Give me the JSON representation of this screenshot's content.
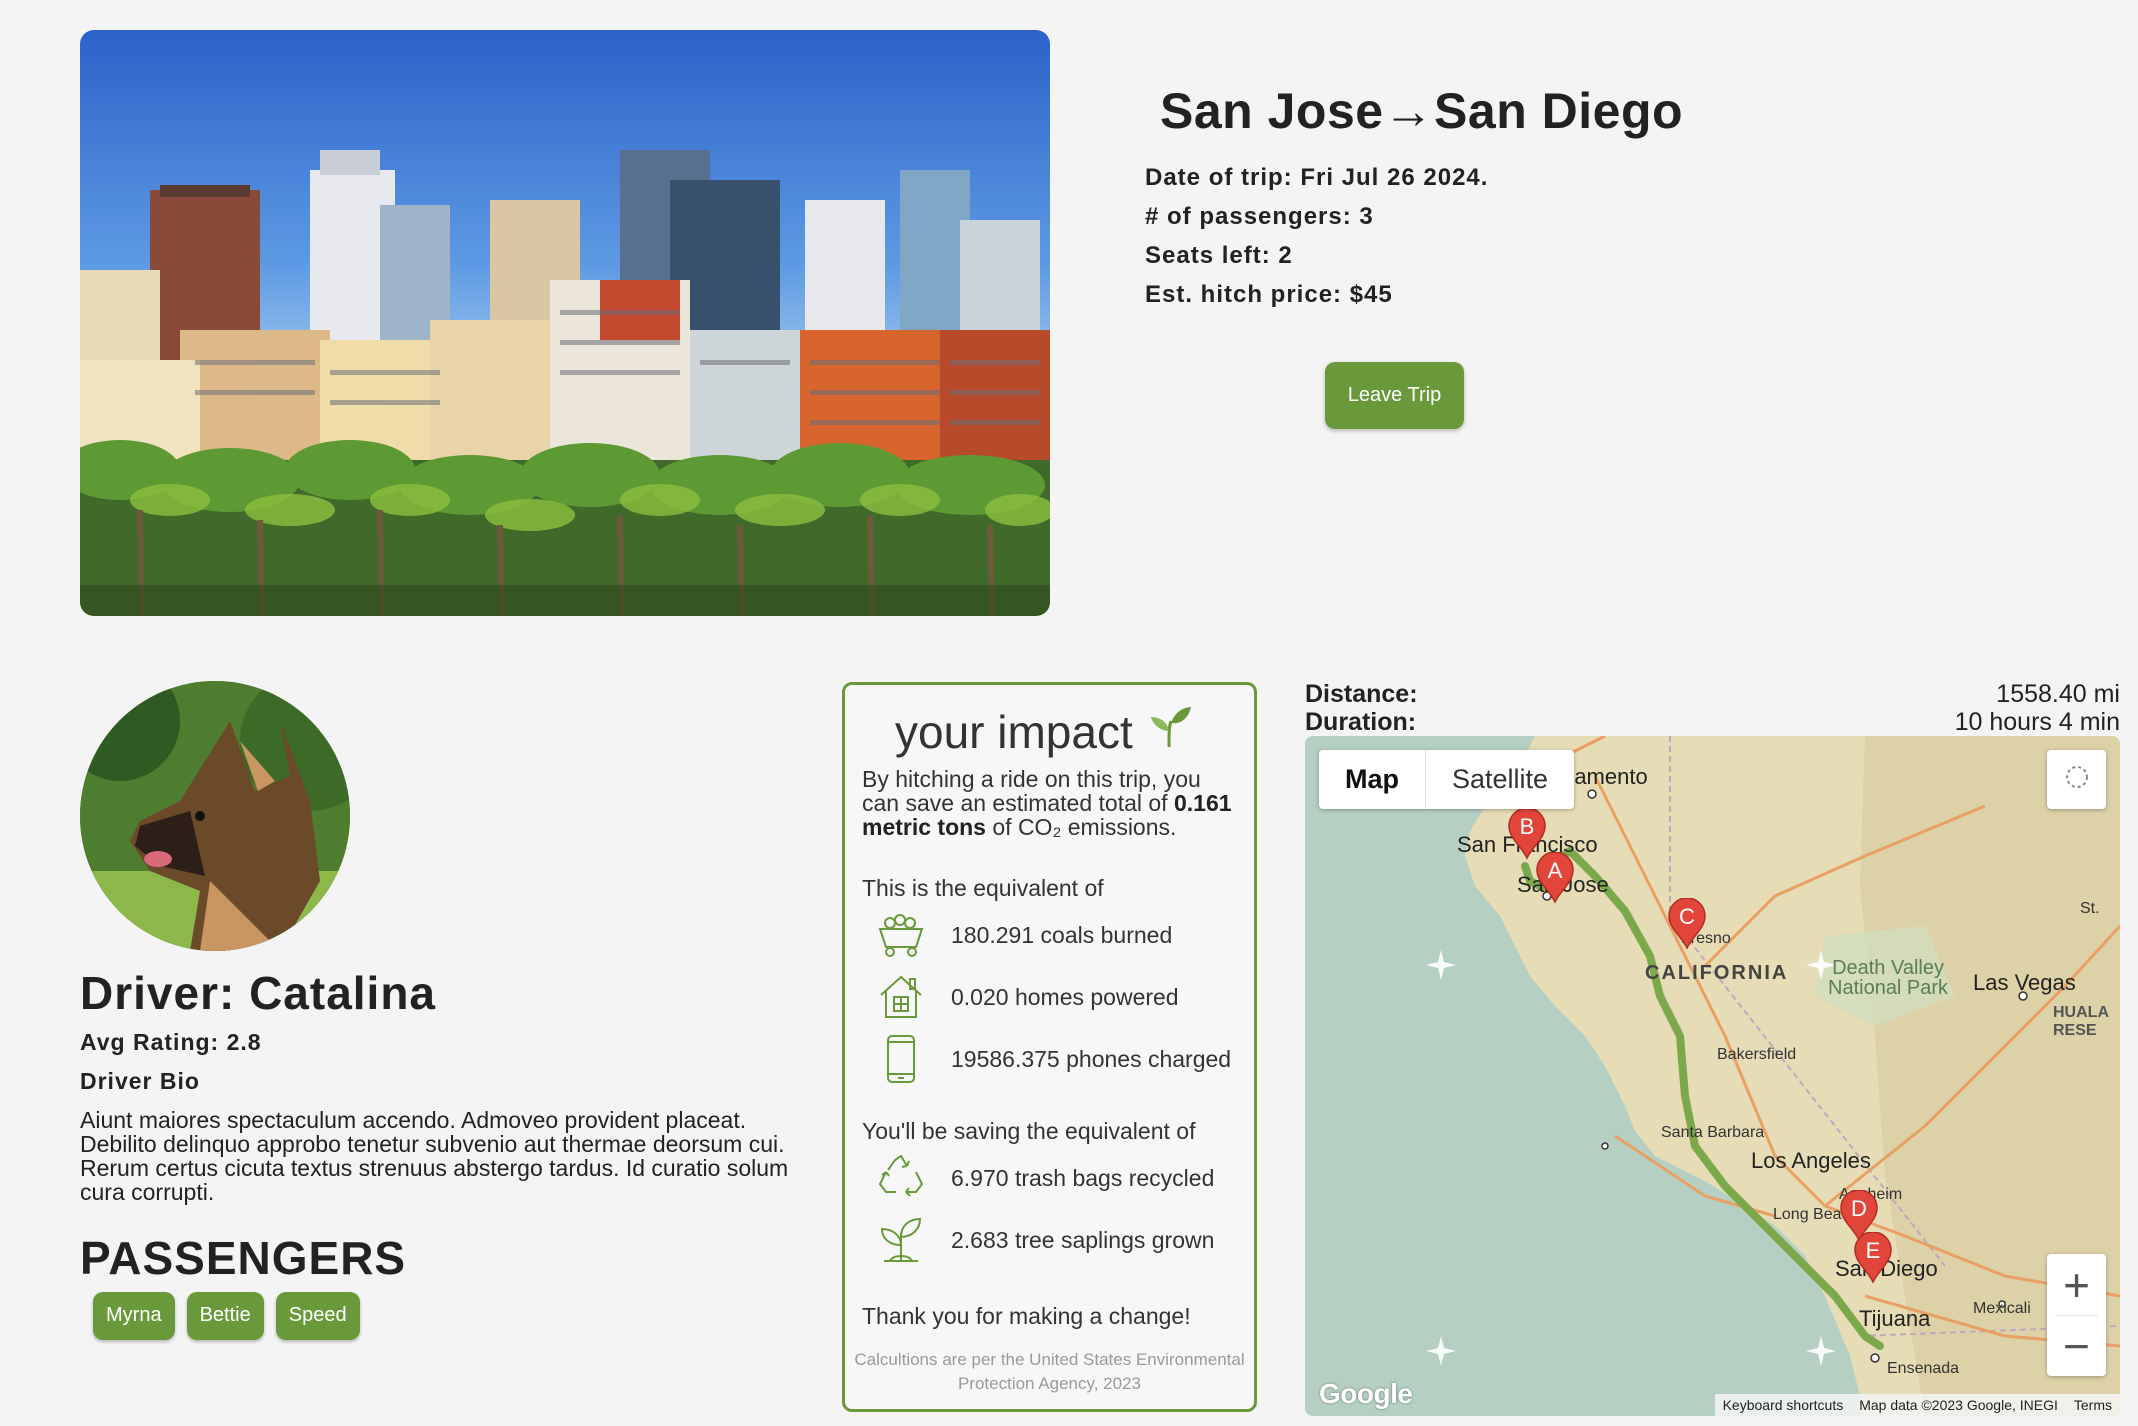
{
  "trip": {
    "title": "San Jose→San Diego",
    "date": "Date of trip: Fri Jul 26 2024.",
    "passengers_count": "# of passengers: 3",
    "seats_left": "Seats left: 2",
    "price": "Est. hitch price: $45",
    "leave_label": "Leave Trip"
  },
  "driver": {
    "name": "Driver: Catalina",
    "rating": "Avg Rating: 2.8",
    "bio_label": "Driver Bio",
    "bio": "Aiunt maiores spectaculum accendo. Admoveo provident placeat. Debilito delinquo approbo tenetur subvenio aut thermae deorsum cui. Rerum certus cicuta textus strenuus abstergo tardus. Id curatio solum cura corrupti."
  },
  "passengers": {
    "title": "PASSENGERS",
    "names": [
      "Myrna",
      "Bettie",
      "Speed"
    ]
  },
  "impact": {
    "title": "your impact",
    "intro_pre": "By hitching a ride on this trip, you can save an estimated total of",
    "intro_amount": "0.161 metric tons",
    "intro_post": "of CO₂ emissions.",
    "equivalent_label": "This is the equivalent of",
    "equivalents": [
      {
        "icon": "coal-cart-icon",
        "text": "180.291 coals burned"
      },
      {
        "icon": "house-icon",
        "text": "0.020 homes powered"
      },
      {
        "icon": "phone-icon",
        "text": "19586.375 phones charged"
      }
    ],
    "saving_label": "You'll be saving the equivalent of",
    "savings": [
      {
        "icon": "recycle-icon",
        "text": "6.970 trash bags recycled"
      },
      {
        "icon": "sapling-icon",
        "text": "2.683 tree saplings grown"
      }
    ],
    "thanks": "Thank you for making a change!",
    "footnote": "Calcultions are per the United States Environmental Protection Agency, 2023"
  },
  "route": {
    "distance_label": "Distance:",
    "duration_label": "Duration:",
    "distance_value": "1558.40 mi",
    "duration_value": "10 hours 4 min"
  },
  "map": {
    "type_map": "Map",
    "type_satellite": "Satellite",
    "zoom_in": "+",
    "zoom_out": "−",
    "logo": "Google",
    "shortcuts": "Keyboard shortcuts",
    "data_credit": "Map data ©2023 Google, INEGI",
    "terms": "Terms",
    "labels": {
      "sacramento": "ramento",
      "san_francisco": "San Francisco",
      "san_jose": "San Jose",
      "fresno": "Fresno",
      "california": "CALIFORNIA",
      "death_valley_1": "Death Valley",
      "death_valley_2": "National Park",
      "las_vegas": "Las Vegas",
      "hualapai_1": "HUALA",
      "hualapai_2": "RESE",
      "st": "St.",
      "bakersfield": "Bakersfield",
      "santa_barbara": "Santa Barbara",
      "los_angeles": "Los Angeles",
      "anaheim": "Anaheim",
      "long_beach": "Long Beach",
      "san_diego": "San Diego",
      "tijuana": "Tijuana",
      "mexicali": "Mexicali",
      "ensenada": "Ensenada"
    },
    "markers": [
      "A",
      "B",
      "C",
      "D",
      "E"
    ]
  },
  "colors": {
    "accent_green": "#6a993b",
    "route_green": "#7ba84a",
    "marker_red": "#e2463a"
  }
}
